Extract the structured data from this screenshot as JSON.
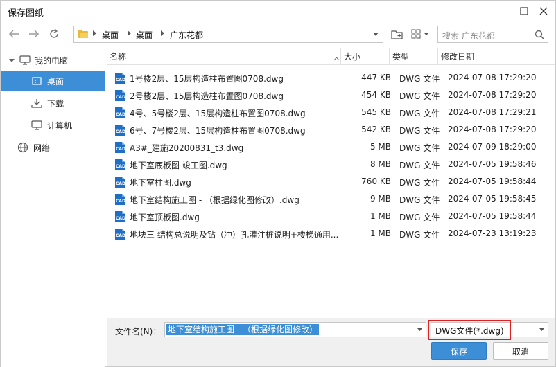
{
  "window": {
    "title": "保存图纸"
  },
  "address": {
    "crumbs": [
      "桌面",
      "桌面",
      "广东花都"
    ]
  },
  "search": {
    "placeholder": "搜索 广东花都"
  },
  "sidebar": {
    "items": [
      {
        "label": "我的电脑",
        "icon": "computer-icon"
      },
      {
        "label": "桌面",
        "icon": "desktop-icon"
      },
      {
        "label": "下载",
        "icon": "download-icon"
      },
      {
        "label": "计算机",
        "icon": "monitor-icon"
      },
      {
        "label": "网络",
        "icon": "globe-icon"
      }
    ]
  },
  "columns": {
    "name": "名称",
    "size": "大小",
    "type": "类型",
    "date": "修改日期"
  },
  "files": [
    {
      "name": "1号楼2层、15层构造柱布置图0708.dwg",
      "size": "447 KB",
      "type": "DWG 文件",
      "date": "2024-07-08 17:29:20"
    },
    {
      "name": "2号楼2层、15层构造柱布置图0708.dwg",
      "size": "454 KB",
      "type": "DWG 文件",
      "date": "2024-07-08 17:29:20"
    },
    {
      "name": "4号、5号楼2层、15层构造柱布置图0708.dwg",
      "size": "545 KB",
      "type": "DWG 文件",
      "date": "2024-07-08 17:29:21"
    },
    {
      "name": "6号、7号楼2层、15层构造柱布置图0708.dwg",
      "size": "542 KB",
      "type": "DWG 文件",
      "date": "2024-07-08 17:29:20"
    },
    {
      "name": "A3#_建施20200831_t3.dwg",
      "size": "5 MB",
      "type": "DWG 文件",
      "date": "2024-07-09 18:29:00"
    },
    {
      "name": "地下室底板图 竣工图.dwg",
      "size": "8 MB",
      "type": "DWG 文件",
      "date": "2024-07-05 19:58:46"
    },
    {
      "name": "地下室柱图.dwg",
      "size": "760 KB",
      "type": "DWG 文件",
      "date": "2024-07-05 19:58:44"
    },
    {
      "name": "地下室结构施工图 - （根据绿化图修改）.dwg",
      "size": "9 MB",
      "type": "DWG 文件",
      "date": "2024-07-05 19:58:45"
    },
    {
      "name": "地下室顶板图.dwg",
      "size": "1 MB",
      "type": "DWG 文件",
      "date": "2024-07-05 19:58:44"
    },
    {
      "name": "地块三 结构总说明及钻（冲）孔灌注桩说明+楼梯通用...",
      "size": "1 MB",
      "type": "DWG 文件",
      "date": "2024-07-23 13:19:23"
    }
  ],
  "footer": {
    "filename_label": "文件名(N)：",
    "filename_value": "地下室结构施工图 - （根据绿化图修改）",
    "filetype_value": "DWG文件(*.dwg)",
    "save_label": "保存",
    "cancel_label": "取消"
  },
  "colors": {
    "accent": "#3c8fd6",
    "highlight": "#e02020",
    "cad_icon": "#1f6fc7"
  }
}
